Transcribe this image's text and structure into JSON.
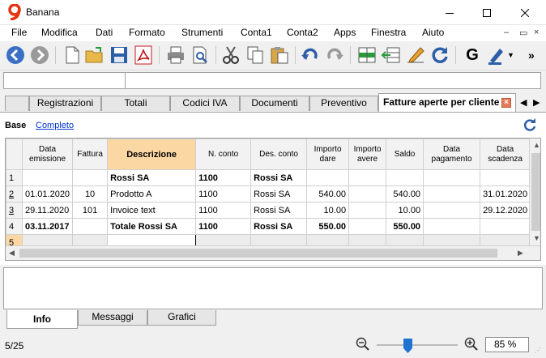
{
  "window": {
    "title": "Banana"
  },
  "menu": [
    "File",
    "Modifica",
    "Dati",
    "Formato",
    "Strumenti",
    "Conta1",
    "Conta2",
    "Apps",
    "Finestra",
    "Aiuto"
  ],
  "toolbar": {
    "more": "»",
    "g_label": "G"
  },
  "tabs": [
    "Registrazioni",
    "Totali",
    "Codici IVA",
    "Documenti",
    "Preventivo",
    "Fatture aperte per cliente"
  ],
  "views": {
    "base": "Base",
    "completo": "Completo"
  },
  "table": {
    "headers": [
      "Data emissione",
      "Fattura",
      "Descrizione",
      "N. conto",
      "Des. conto",
      "Importo dare",
      "Importo avere",
      "Saldo",
      "Data pagamento",
      "Data scadenza"
    ],
    "rows": [
      {
        "n": "1",
        "cells": [
          "",
          "",
          "Rossi SA",
          "1100",
          "Rossi SA",
          "",
          "",
          "",
          "",
          ""
        ]
      },
      {
        "n": "2",
        "cells": [
          "01.01.2020",
          "10",
          "Prodotto A",
          "1100",
          "Rossi SA",
          "540.00",
          "",
          "540.00",
          "",
          "31.01.2020"
        ]
      },
      {
        "n": "3",
        "cells": [
          "29.11.2020",
          "101",
          "Invoice text",
          "1100",
          "Rossi SA",
          "10.00",
          "",
          "10.00",
          "",
          "29.12.2020"
        ]
      },
      {
        "n": "4",
        "cells": [
          "03.11.2017",
          "",
          "Totale Rossi SA",
          "1100",
          "Rossi SA",
          "550.00",
          "",
          "550.00",
          "",
          ""
        ]
      },
      {
        "n": "5",
        "cells": [
          "",
          "",
          "",
          "",
          "",
          "",
          "",
          "",
          "",
          ""
        ]
      }
    ]
  },
  "bottom_tabs": [
    "Info",
    "Messaggi",
    "Grafici"
  ],
  "status": {
    "count": "5/25",
    "zoom": "85 %",
    "zoom_level": 0.38
  }
}
